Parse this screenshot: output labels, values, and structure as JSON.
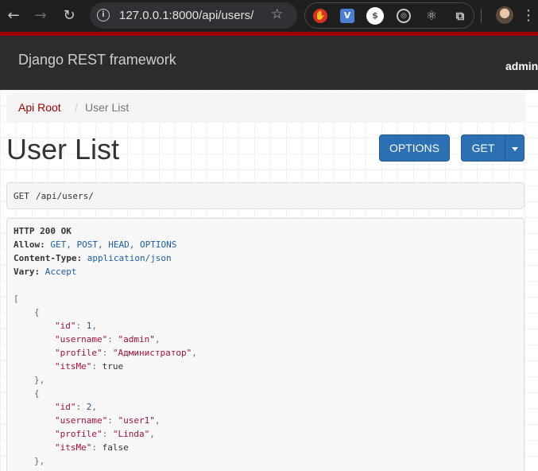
{
  "browser": {
    "url_host": "127.0.0.1:8000",
    "url_path": "/api/users/",
    "ext_icons": [
      "hand-stop-icon",
      "v-icon",
      "dollar-icon",
      "target-icon",
      "react-icon",
      "puzzle-icon"
    ]
  },
  "navbar": {
    "brand": "Django REST framework",
    "user": "admin",
    "accent_color": "#a30000"
  },
  "breadcrumb": {
    "root": "Api Root",
    "separator": "/",
    "current": "User List"
  },
  "page": {
    "title": "User List",
    "options_label": "OPTIONS",
    "get_label": "GET"
  },
  "request": {
    "method": "GET",
    "path": "/api/users/"
  },
  "response": {
    "status": "HTTP 200 OK",
    "headers": [
      {
        "name": "Allow:",
        "value": "GET, POST, HEAD, OPTIONS"
      },
      {
        "name": "Content-Type:",
        "value": "application/json"
      },
      {
        "name": "Vary:",
        "value": "Accept"
      }
    ],
    "users": [
      {
        "id": "1",
        "username": "\"admin\"",
        "profile": "\"Администратор\"",
        "itsMe": "true"
      },
      {
        "id": "2",
        "username": "\"user1\"",
        "profile": "\"Linda\"",
        "itsMe": "false"
      }
    ],
    "keys": {
      "id": "\"id\"",
      "username": "\"username\"",
      "profile": "\"profile\"",
      "itsMe": "\"itsMe\""
    },
    "open_bracket": "[",
    "open_brace": "{",
    "close_brace": "},"
  }
}
